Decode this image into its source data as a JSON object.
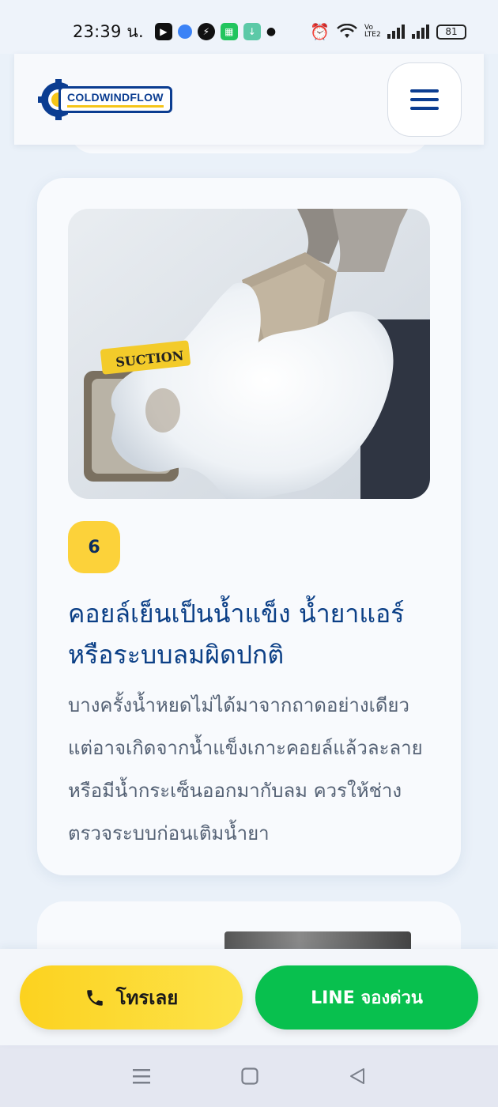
{
  "status_bar": {
    "time": "23:39 น.",
    "volte_label": "Vo\nLTE2",
    "battery": "81"
  },
  "header": {
    "logo_text": "COLDWINDFLOW",
    "menu_icon": "hamburger-icon"
  },
  "card": {
    "image_label": "SUCTION",
    "step_number": "6",
    "title": "คอยล์เย็นเป็นน้ำแข็ง น้ำยาแอร์หรือระบบลมผิดปกติ",
    "text": "บางครั้งน้ำหยดไม่ได้มาจากถาดอย่างเดียว แต่อาจเกิดจากน้ำแข็งเกาะคอยล์แล้วละลาย หรือมีน้ำกระเซ็นออกมากับลม ควรให้ช่างตรวจระบบก่อนเติมน้ำยา"
  },
  "cta": {
    "call_label": "โทรเลย",
    "line_label": "LINE จองด่วน"
  },
  "colors": {
    "brand_blue": "#0b3d91",
    "badge_yellow": "#fcd23a",
    "line_green": "#08c04e"
  }
}
